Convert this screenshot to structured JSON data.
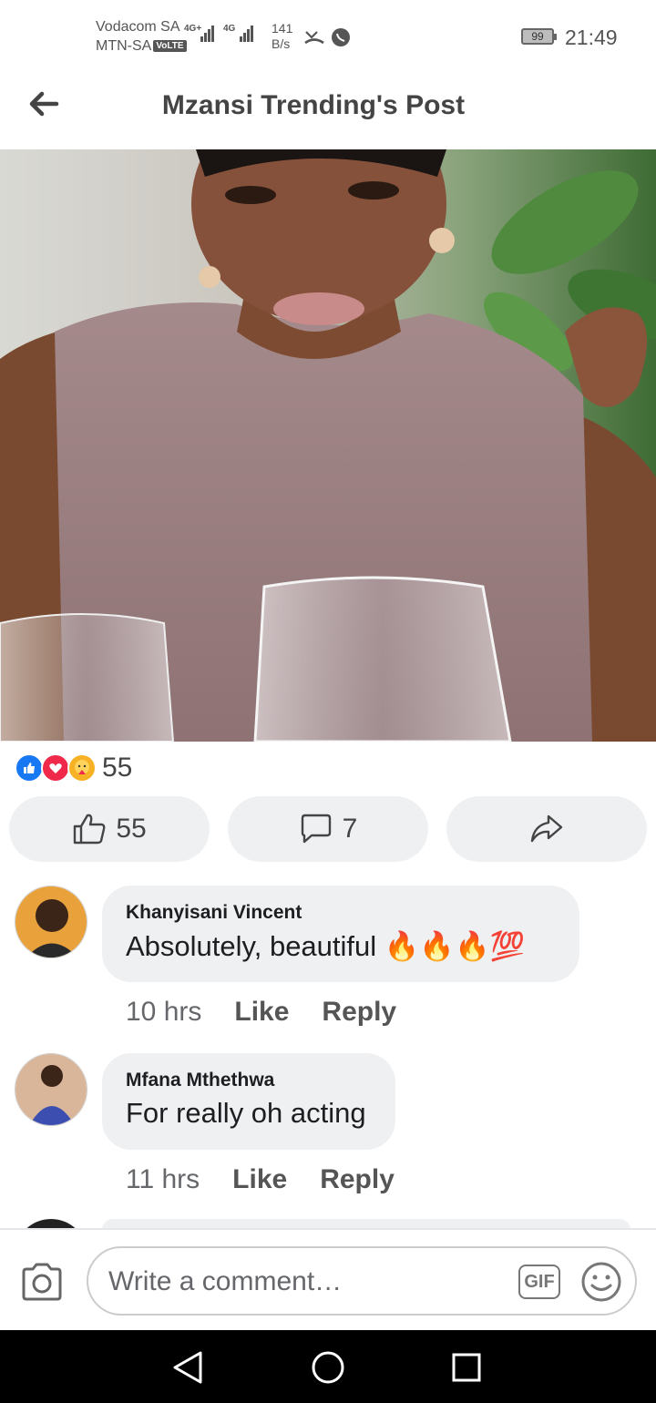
{
  "status_bar": {
    "carrier1": "Vodacom SA",
    "carrier2": "MTN-SA",
    "volte": "VoLTE",
    "net1": "4G+",
    "net2": "4G",
    "speed_value": "141",
    "speed_unit": "B/s",
    "battery": "99",
    "time": "21:49"
  },
  "header": {
    "back_icon": "arrow-left-icon",
    "title": "Mzansi Trending's Post"
  },
  "post": {
    "photo_description_icon": "post-photo",
    "reaction_icons": [
      "like-reaction-icon",
      "love-reaction-icon",
      "care-reaction-icon"
    ],
    "reaction_count": "55",
    "like_count": "55",
    "comment_count": "7"
  },
  "comments": [
    {
      "name": "Khanyisani Vincent",
      "text": "Absolutely, beautiful 🔥🔥🔥💯",
      "time": "10 hrs",
      "like": "Like",
      "reply": "Reply"
    },
    {
      "name": "Mfana Mthethwa",
      "text": "For really oh acting",
      "time": "11 hrs",
      "like": "Like",
      "reply": "Reply"
    }
  ],
  "composer": {
    "placeholder": "Write a comment…",
    "gif_label": "GIF"
  },
  "colors": {
    "accent_blue": "#1877f2",
    "love_red": "#f02849",
    "care_yellow": "#f7b125",
    "bubble_bg": "#eff0f2"
  }
}
